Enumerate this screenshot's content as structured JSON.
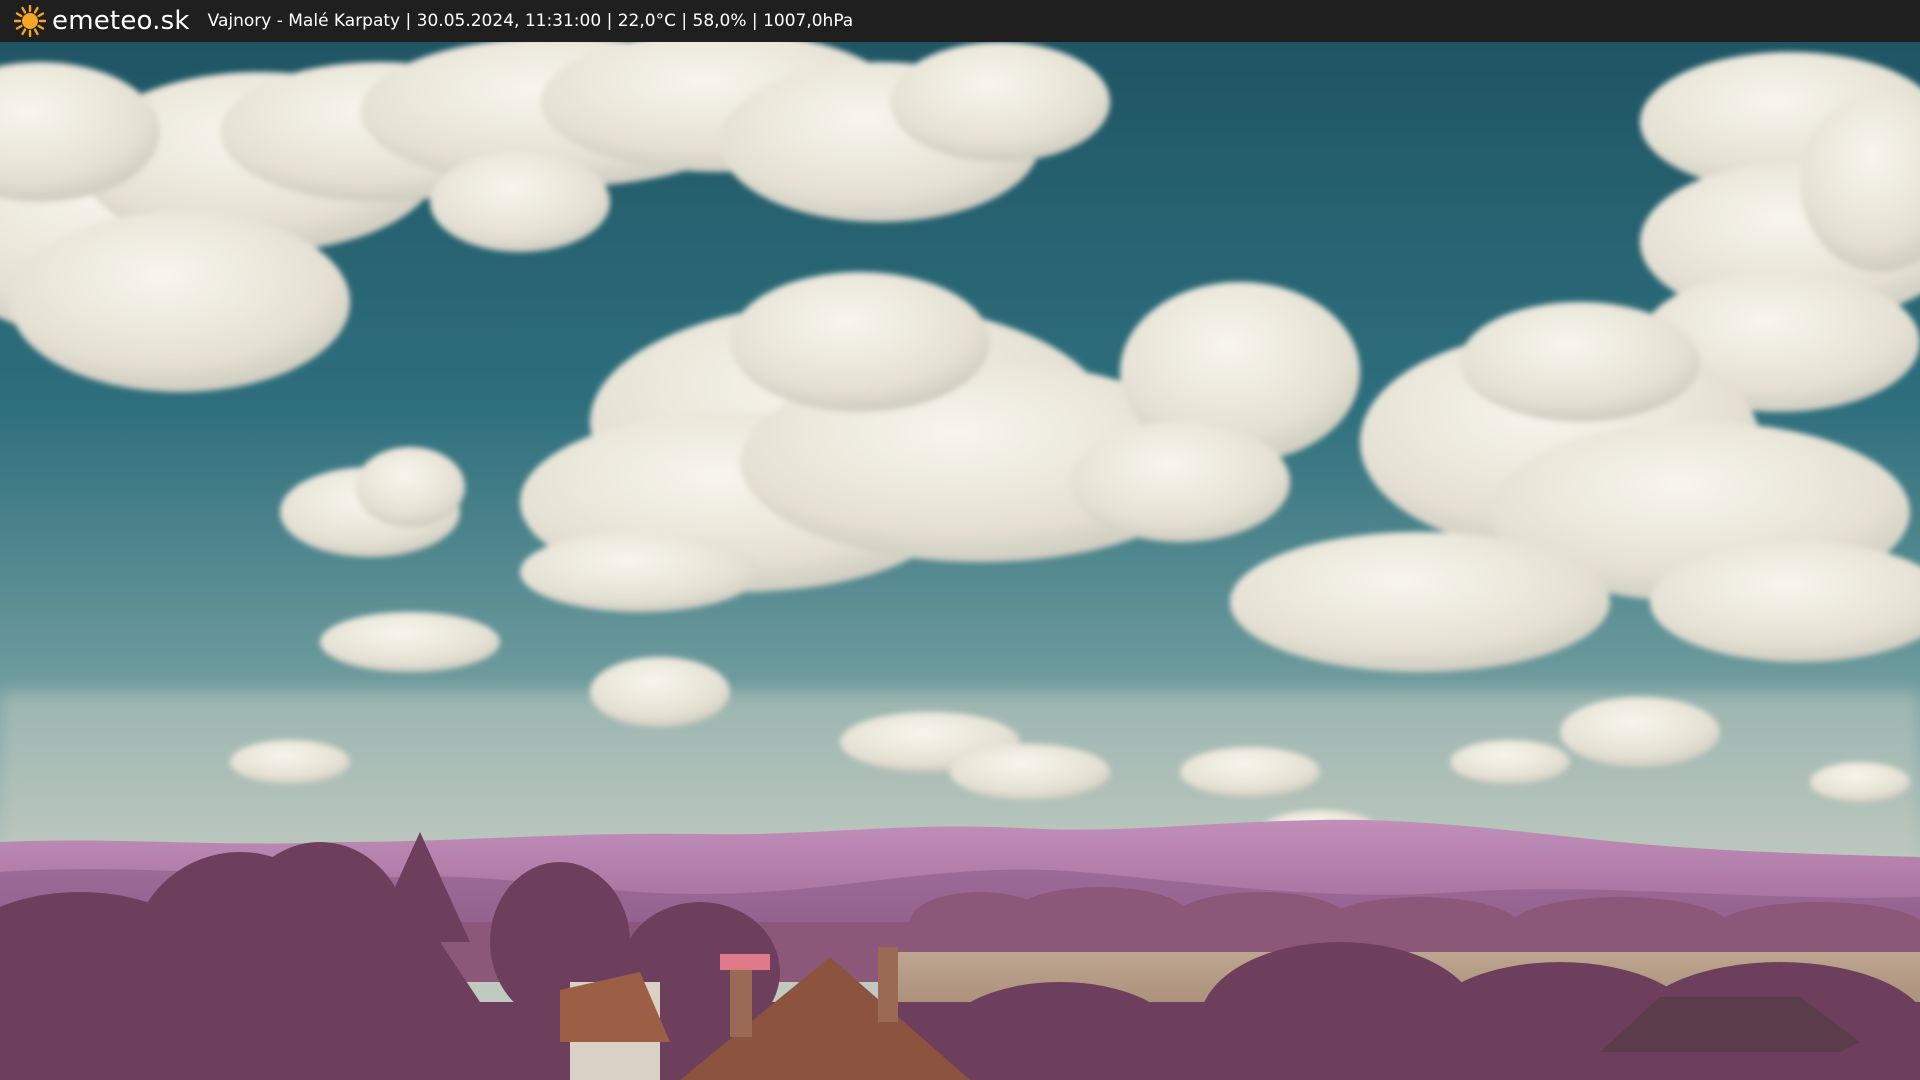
{
  "header": {
    "brand": "emeteo.sk",
    "logo_icon": "sun-icon",
    "station": "Vajnory - Malé Karpaty",
    "datetime": "30.05.2024, 11:31:00",
    "temperature": "22,0°C",
    "humidity": "58,0%",
    "pressure": "1007,0hPa",
    "separator": " | "
  },
  "colors": {
    "bar_background": "#1f1f1f",
    "sun": "#f5a623",
    "sky_top": "#25606f",
    "sky_horizon": "#b9c4bd",
    "cloud": "#ece8dc",
    "hills": "#b27fae",
    "trees": "#7a4a66",
    "field": "#b59c86",
    "roof": "#9a5a40"
  }
}
